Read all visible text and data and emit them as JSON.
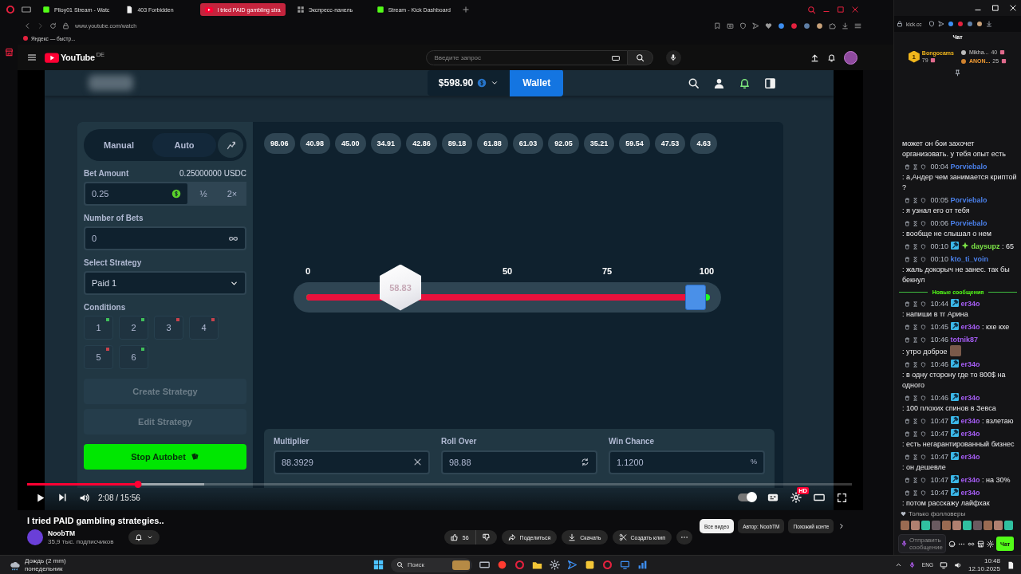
{
  "browser": {
    "tabs": [
      {
        "label": "Plloy01 Stream - Watc",
        "selected": false,
        "kind": "kick"
      },
      {
        "label": "403 Forbidden",
        "selected": false,
        "kind": "page"
      },
      {
        "label": "I tried PAID gambling stra",
        "selected": true,
        "kind": "youtube"
      },
      {
        "label": "Экспресс-панель",
        "selected": false,
        "kind": "speeddial"
      },
      {
        "label": "Stream - Kick Dashboard",
        "selected": false,
        "kind": "kick"
      }
    ],
    "url": "www.youtube.com/watch",
    "bookmark": "Яндекс — быстр..."
  },
  "youtube": {
    "logo": "YouTube",
    "region": "DE",
    "search": {
      "placeholder": "Введите запрос"
    }
  },
  "game": {
    "balance": "$598.90",
    "wallet": "Wallet",
    "mode_tabs": [
      {
        "label": "Manual",
        "selected": false
      },
      {
        "label": "Auto",
        "selected": true
      }
    ],
    "bet_amount": {
      "label": "Bet Amount",
      "reading": "0.25000000 USDC",
      "value": "0.25",
      "half": "½",
      "double": "2×"
    },
    "number_of_bets": {
      "label": "Number of Bets",
      "value": "0"
    },
    "strategy": {
      "label": "Select Strategy",
      "value": "Paid 1"
    },
    "conditions": {
      "label": "Conditions",
      "items": [
        {
          "label": "1",
          "color": "#3fbf5a"
        },
        {
          "label": "2",
          "color": "#3fbf5a"
        },
        {
          "label": "3",
          "color": "#c8424c"
        },
        {
          "label": "4",
          "color": "#c8424c"
        },
        {
          "label": "5",
          "color": "#c8424c"
        },
        {
          "label": "6",
          "color": "#3fbf5a"
        }
      ]
    },
    "create_button": "Create Strategy",
    "edit_button": "Edit Strategy",
    "stop_button": "Stop Autobet",
    "history": [
      "98.06",
      "40.98",
      "45.00",
      "34.91",
      "42.86",
      "89.18",
      "61.88",
      "61.03",
      "92.05",
      "35.21",
      "59.54",
      "47.53",
      "4.63"
    ],
    "slider": {
      "ticks": [
        "0",
        "50",
        "75",
        "100"
      ],
      "result": "58.83",
      "level": 0.965
    },
    "fields": [
      {
        "label": "Multiplier",
        "value": "88.3929",
        "kind": "clear"
      },
      {
        "label": "Roll Over",
        "value": "98.88",
        "kind": "swap"
      },
      {
        "label": "Win Chance",
        "value": "1.1200",
        "kind": "percent",
        "suffix": "%"
      }
    ]
  },
  "player": {
    "level": 0.134,
    "buffer": {
      "level": 0.215
    },
    "time": "2:08 / 15:56",
    "autoplay": true,
    "badge": "HD"
  },
  "video_info": {
    "title": "I tried PAID gambling strategies..",
    "channel": "NoobTM",
    "subscribers": "35,9 тыс. подписчиков",
    "likes": "56",
    "actions": [
      {
        "label": "Поделиться",
        "kind": "share"
      },
      {
        "label": "Скачать",
        "kind": "download"
      },
      {
        "label": "Создать клип",
        "kind": "clip"
      }
    ],
    "chips": [
      {
        "label": "Все видео",
        "selected": true
      },
      {
        "label": "Автор: NoobTM",
        "selected": false
      },
      {
        "label": "Похожий конте",
        "selected": false
      }
    ]
  },
  "chat": {
    "url": "kick.cc",
    "title": "Чат",
    "top": {
      "rank": "1",
      "name": "Bongocams",
      "score": "79"
    },
    "others": [
      {
        "name": "Mikha...",
        "score": "40"
      },
      {
        "name": "ANON...",
        "score": "25"
      }
    ],
    "messages": [
      {
        "kind": "continued",
        "text": "может он бои захочет организовать. у тебя опыт есть"
      },
      {
        "kind": "message",
        "time": "00:04",
        "user": "Porviebalo",
        "color": "#4a7fe8",
        "text": ": а,Андер чем занимается криптой ?",
        "moderator": false,
        "vip": false,
        "emote": false
      },
      {
        "kind": "message",
        "time": "00:05",
        "user": "Porviebalo",
        "color": "#4a7fe8",
        "text": ": я узнал его от тебя",
        "moderator": false,
        "vip": false,
        "emote": false
      },
      {
        "kind": "message",
        "time": "00:06",
        "user": "Porviebalo",
        "color": "#4a7fe8",
        "text": ": вообще не слышал о нем",
        "moderator": false,
        "vip": false,
        "emote": false
      },
      {
        "kind": "message",
        "time": "00:10",
        "user": "daysupz",
        "color": "#7be246",
        "text": ": 65",
        "moderator": true,
        "vip": true,
        "emote": false
      },
      {
        "kind": "message",
        "time": "00:10",
        "user": "kto_ti_voin",
        "color": "#4a7fe8",
        "text": ": жаль докорыч не занес. так бы бекнул",
        "moderator": false,
        "vip": false,
        "emote": false
      },
      {
        "kind": "divider",
        "text": "Новые сообщения"
      },
      {
        "kind": "message",
        "time": "10:44",
        "user": "er34o",
        "color": "#a45cf2",
        "text": ": напиши в тг Арина",
        "moderator": true,
        "vip": false,
        "emote": false
      },
      {
        "kind": "message",
        "time": "10:45",
        "user": "er34o",
        "color": "#a45cf2",
        "text": ": кхе кхе",
        "moderator": true,
        "vip": false,
        "emote": false
      },
      {
        "kind": "message",
        "time": "10:46",
        "user": "totnik87",
        "color": "#a45cf2",
        "text": ": утро доброе",
        "moderator": false,
        "vip": false,
        "emote": true
      },
      {
        "kind": "message",
        "time": "10:46",
        "user": "er34o",
        "color": "#a45cf2",
        "text": ": в одну сторону где то 800$ на одного",
        "moderator": true,
        "vip": false,
        "emote": false
      },
      {
        "kind": "message",
        "time": "10:46",
        "user": "er34o",
        "color": "#a45cf2",
        "text": ": 100 плохих спинов в Зевса",
        "moderator": true,
        "vip": false,
        "emote": false
      },
      {
        "kind": "message",
        "time": "10:47",
        "user": "er34o",
        "color": "#a45cf2",
        "text": ": взлетаю",
        "moderator": true,
        "vip": false,
        "emote": false
      },
      {
        "kind": "message",
        "time": "10:47",
        "user": "er34o",
        "color": "#a45cf2",
        "text": ": есть негарантированный бизнес",
        "moderator": true,
        "vip": false,
        "emote": false
      },
      {
        "kind": "message",
        "time": "10:47",
        "user": "er34o",
        "color": "#a45cf2",
        "text": ": он дешевле",
        "moderator": true,
        "vip": false,
        "emote": false
      },
      {
        "kind": "message",
        "time": "10:47",
        "user": "er34o",
        "color": "#a45cf2",
        "text": ": на 30%",
        "moderator": true,
        "vip": false,
        "emote": false
      },
      {
        "kind": "message",
        "time": "10:47",
        "user": "er34o",
        "color": "#a45cf2",
        "text": ": потом расскажу лайфхак",
        "moderator": true,
        "vip": false,
        "emote": false
      }
    ],
    "followers_only": "Только фолловеры",
    "input": {
      "placeholder": "Отправить сообщение"
    },
    "send": "Чат"
  },
  "taskbar": {
    "weather": "Дождь (2 mm)",
    "day": "понедельник",
    "search": {
      "placeholder": "Поиск"
    },
    "language": "ENG",
    "time": "10:48",
    "date": "12.10.2025"
  }
}
